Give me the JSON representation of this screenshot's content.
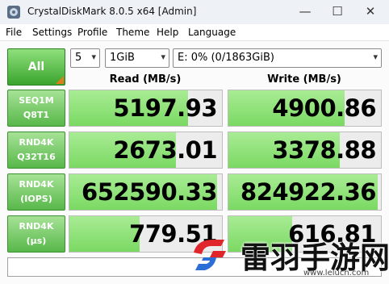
{
  "window": {
    "title": "CrystalDiskMark 8.0.5 x64 [Admin]",
    "minimize_glyph": "—",
    "maximize_glyph": "☐",
    "close_glyph": "✕"
  },
  "menu": [
    {
      "label": "File"
    },
    {
      "label": "Settings"
    },
    {
      "label": "Profile"
    },
    {
      "label": "Theme"
    },
    {
      "label": "Help"
    },
    {
      "label": "Language"
    }
  ],
  "controls": {
    "all_label": "All",
    "count": "5",
    "size": "1GiB",
    "drive": "E: 0% (0/1863GiB)",
    "dropdown_glyph": "▾"
  },
  "headers": {
    "read": "Read (MB/s)",
    "write": "Write (MB/s)"
  },
  "tests": [
    {
      "line1": "SEQ1M",
      "line2": "Q8T1",
      "read": "5197.93",
      "write": "4900.86",
      "read_fill": 0.78,
      "write_fill": 0.76
    },
    {
      "line1": "RND4K",
      "line2": "Q32T16",
      "read": "2673.01",
      "write": "3378.88",
      "read_fill": 0.7,
      "write_fill": 0.73
    },
    {
      "line1": "RND4K",
      "line2": "(IOPS)",
      "read": "652590.33",
      "write": "824922.36",
      "read_fill": 0.97,
      "write_fill": 0.98
    },
    {
      "line1": "RND4K",
      "line2": "(μs)",
      "read": "779.51",
      "write": "616.81",
      "read_fill": 0.46,
      "write_fill": 0.42
    }
  ],
  "comment": "",
  "watermark": {
    "name": "雷羽手游网",
    "url": "www.leiucn.com",
    "colors": {
      "red": "#e0262b",
      "blue": "#2b6fd6"
    }
  }
}
